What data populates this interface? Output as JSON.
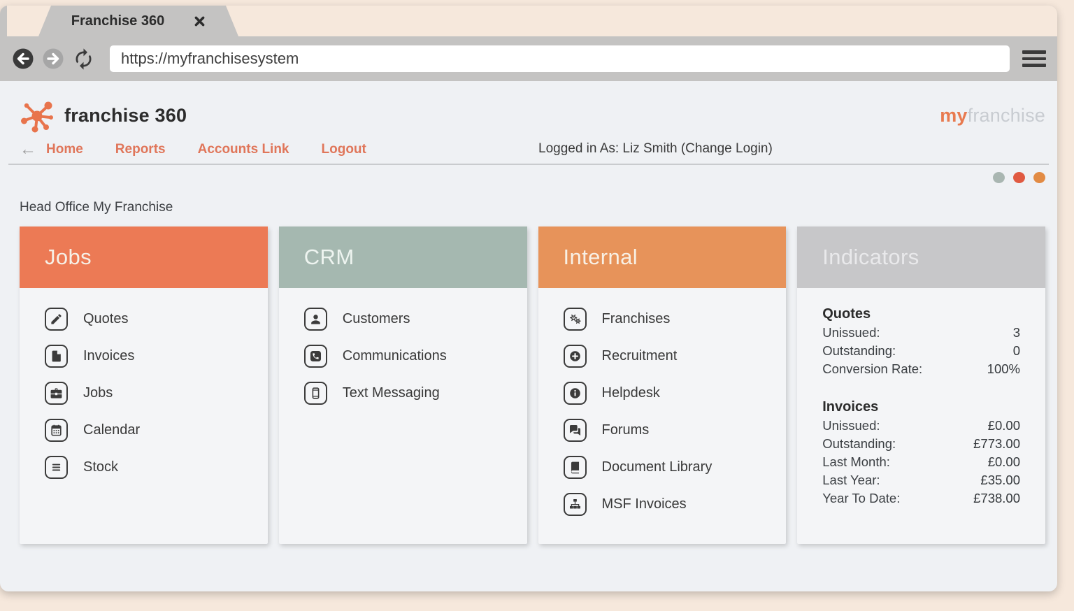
{
  "browser": {
    "tab_title": "Franchise 360",
    "url": "https://myfranchisesystem"
  },
  "header": {
    "logo_text": "franchise 360",
    "brand_right": {
      "my": "my",
      "franchise": "franchise",
      "my_color": "#e87a4f",
      "franchise_color": "#c8ccd1"
    },
    "nav": [
      {
        "label": "Home"
      },
      {
        "label": "Reports"
      },
      {
        "label": "Accounts Link"
      },
      {
        "label": "Logout"
      }
    ],
    "logged_in_prefix": "Logged in As: Liz Smith ",
    "change_login": "(Change Login)",
    "status_dots": [
      "#a9b6b1",
      "#e05a41",
      "#e28b44"
    ]
  },
  "page": {
    "section_label": "Head Office My Franchise"
  },
  "cards": [
    {
      "title": "Jobs",
      "header_color": "#ec7a55",
      "header_text_color": "#f6f0e7",
      "items": [
        {
          "icon": "pencil-icon",
          "label": "Quotes"
        },
        {
          "icon": "file-icon",
          "label": "Invoices"
        },
        {
          "icon": "briefcase-icon",
          "label": "Jobs"
        },
        {
          "icon": "calendar-icon",
          "label": "Calendar"
        },
        {
          "icon": "list-icon",
          "label": "Stock"
        }
      ]
    },
    {
      "title": "CRM",
      "header_color": "#a5b8b0",
      "header_text_color": "#eef4f0",
      "items": [
        {
          "icon": "user-icon",
          "label": "Customers"
        },
        {
          "icon": "phone-icon",
          "label": "Communications"
        },
        {
          "icon": "mobile-icon",
          "label": "Text Messaging"
        }
      ]
    },
    {
      "title": "Internal",
      "header_color": "#e7935a",
      "header_text_color": "#f8f0e5",
      "items": [
        {
          "icon": "cogs-icon",
          "label": "Franchises"
        },
        {
          "icon": "plus-circle-icon",
          "label": "Recruitment"
        },
        {
          "icon": "info-circle-icon",
          "label": "Helpdesk"
        },
        {
          "icon": "comments-icon",
          "label": "Forums"
        },
        {
          "icon": "book-icon",
          "label": "Document Library"
        },
        {
          "icon": "sitemap-icon",
          "label": "MSF Invoices"
        }
      ]
    }
  ],
  "indicators": {
    "title": "Indicators",
    "header_color": "#c7c7c9",
    "header_text_color": "#e9e9eb",
    "sections": [
      {
        "title": "Quotes",
        "rows": [
          {
            "label": "Unissued:",
            "value": "3"
          },
          {
            "label": "Outstanding:",
            "value": "0"
          },
          {
            "label": "Conversion Rate:",
            "value": "100%"
          }
        ]
      },
      {
        "title": "Invoices",
        "rows": [
          {
            "label": "Unissued:",
            "value": "£0.00"
          },
          {
            "label": "Outstanding:",
            "value": "£773.00"
          },
          {
            "label": "Last Month:",
            "value": "£0.00"
          },
          {
            "label": "Last Year:",
            "value": "£35.00"
          },
          {
            "label": "Year To Date:",
            "value": "£738.00"
          }
        ]
      }
    ]
  },
  "colors": {
    "background": "#f6e8dc",
    "chrome": "#c4c3c2",
    "page_bg": "#eff1f4",
    "card_bg": "#f4f5f7",
    "accent_orange": "#e8744c",
    "nav_link": "#e0765a",
    "icon_dark": "#3b3b3b"
  }
}
